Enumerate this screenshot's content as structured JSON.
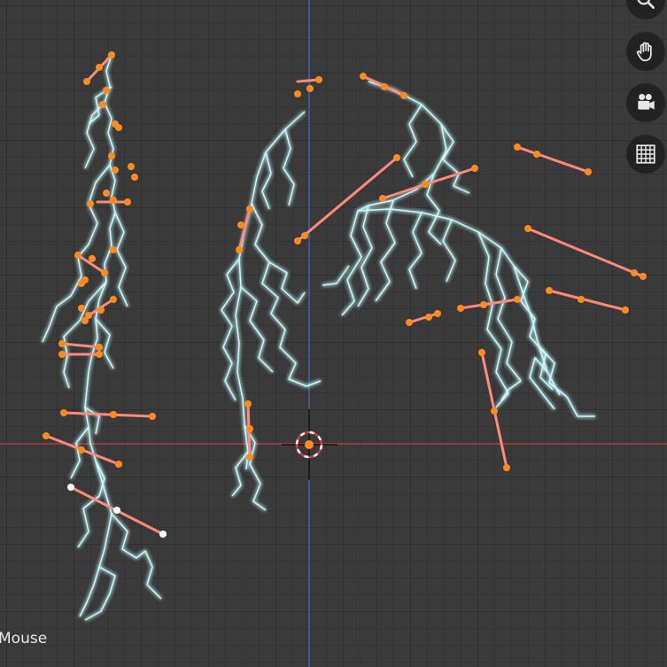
{
  "viewport": {
    "status_text": "Mouse",
    "axis_colors": {
      "x": "#c4423f",
      "y": "#3f6fb5"
    },
    "curve_color": "#c8fbff",
    "handle_color": "#ff8a7a",
    "control_point_color": "#ff8a1e",
    "selected_point_color": "#ffffff"
  },
  "navigation_gizmos": [
    {
      "name": "zoom",
      "icon": "magnifier-icon"
    },
    {
      "name": "pan",
      "icon": "hand-icon"
    },
    {
      "name": "camera",
      "icon": "camera-icon"
    },
    {
      "name": "ortho-toggle",
      "icon": "grid-icon"
    }
  ]
}
